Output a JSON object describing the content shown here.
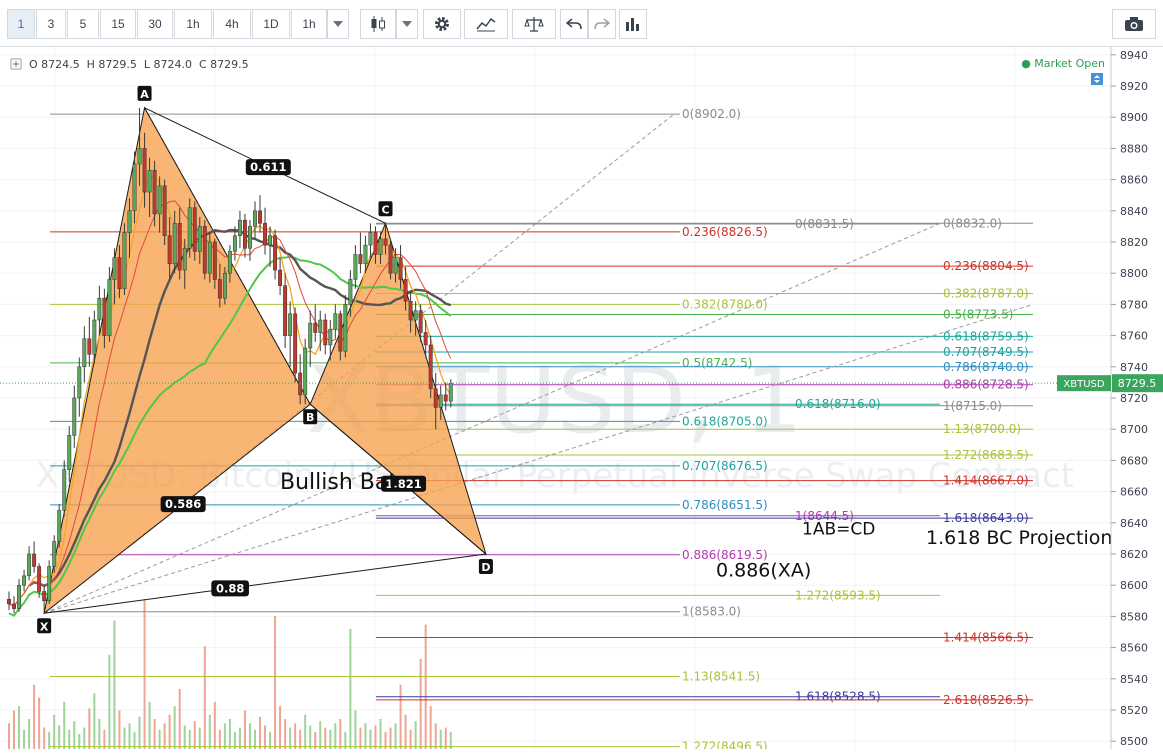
{
  "toolbar": {
    "intervals": [
      "1",
      "3",
      "5",
      "15",
      "30",
      "1h",
      "4h",
      "1D",
      "1h"
    ],
    "active_interval": "1"
  },
  "legend": {
    "ohlc": "O 8724.5  H 8729.5  L 8724.0  C 8729.5",
    "market_status": "● Market Open"
  },
  "watermark": {
    "symbol": "XBTUSD, 1",
    "description": "XBTUSD: Bitcoin / US Dollar Perpetual Inverse Swap Contract"
  },
  "price_tag": {
    "symbol": "XBTUSD",
    "price": "8729.5"
  },
  "colors": {
    "pattern_fill": "#f6a04d",
    "pattern_stroke": "#1a1a1a",
    "ma_green": "#4ec84a",
    "ma_dark": "#555555",
    "ma_orange": "#f5a623",
    "ma_red": "#e24a3a",
    "up_candle": "#5aa85a",
    "down_candle": "#c0392b"
  },
  "chart_data": {
    "type": "candlestick",
    "symbol": "XBTUSD",
    "interval": "1",
    "y_axis": {
      "min": 8495,
      "max": 8945,
      "ticks": [
        8500,
        8520,
        8540,
        8560,
        8580,
        8600,
        8620,
        8640,
        8660,
        8680,
        8700,
        8720,
        8740,
        8760,
        8780,
        8800,
        8820,
        8840,
        8860,
        8880,
        8900,
        8920,
        8940
      ]
    },
    "pattern": {
      "name": "Bullish Bat",
      "points": [
        {
          "label": "X",
          "bar": 7,
          "price": 8582
        },
        {
          "label": "A",
          "bar": 27,
          "price": 8906
        },
        {
          "label": "B",
          "bar": 60,
          "price": 8716
        },
        {
          "label": "C",
          "bar": 75,
          "price": 8832
        },
        {
          "label": "D",
          "bar": 95,
          "price": 8620
        }
      ],
      "ratios": [
        {
          "label": "0.611",
          "price": 8868
        },
        {
          "label": "0.586",
          "price": 8652
        },
        {
          "label": "1.821",
          "price": 8665
        },
        {
          "label": "0.88",
          "price": 8598
        }
      ]
    },
    "annotations": [
      {
        "text": "Bullish Bat",
        "price": 8666
      },
      {
        "text": "1AB=CD",
        "price": 8637
      },
      {
        "text": "1.618 BC Projection",
        "price": 8631
      },
      {
        "text": "0.886(XA)",
        "price": 8610
      }
    ],
    "fib_xa": [
      {
        "label": "0(8902.0)",
        "price": 8902.0,
        "color": "#8c8c8c"
      },
      {
        "label": "0.236(8826.5)",
        "price": 8826.5,
        "color": "#d0322a"
      },
      {
        "label": "0.382(8780.0)",
        "price": 8780.0,
        "color": "#a8c43a"
      },
      {
        "label": "0.5(8742.5)",
        "price": 8742.5,
        "color": "#4caf50"
      },
      {
        "label": "0.618(8705.0)",
        "price": 8705.0,
        "color": "#20a898"
      },
      {
        "label": "0.707(8676.5)",
        "price": 8676.5,
        "color": "#1fa2a0"
      },
      {
        "label": "0.786(8651.5)",
        "price": 8651.5,
        "color": "#2f8fc1"
      },
      {
        "label": "0.886(8619.5)",
        "price": 8619.5,
        "color": "#b03cb0"
      },
      {
        "label": "1(8583.0)",
        "price": 8583.0,
        "color": "#8c8c8c"
      },
      {
        "label": "1.13(8541.5)",
        "price": 8541.5,
        "color": "#a8c43a"
      },
      {
        "label": "1.272(8496.5)",
        "price": 8496.5,
        "color": "#a8c43a"
      }
    ],
    "fib_bc": [
      {
        "label": "0(8831.5)",
        "price": 8831.5,
        "color": "#8c8c8c"
      },
      {
        "label": "0.618(8716.0)",
        "price": 8716.0,
        "color": "#20a898"
      },
      {
        "label": "1(8644.5)",
        "price": 8644.5,
        "color": "#b03cb0"
      },
      {
        "label": "1.272(8593.5)",
        "price": 8593.5,
        "color": "#a8c43a"
      },
      {
        "label": "1.618(8528.5)",
        "price": 8528.5,
        "color": "#3a3aa0"
      }
    ],
    "fib_ext": [
      {
        "label": "0(8832.0)",
        "price": 8832.0,
        "color": "#8c8c8c"
      },
      {
        "label": "0.236(8804.5)",
        "price": 8804.5,
        "color": "#d0322a"
      },
      {
        "label": "0.382(8787.0)",
        "price": 8787.0,
        "color": "#a8c43a"
      },
      {
        "label": "0.5(8773.5)",
        "price": 8773.5,
        "color": "#4caf50"
      },
      {
        "label": "0.618(8759.5)",
        "price": 8759.5,
        "color": "#20a898"
      },
      {
        "label": "0.707(8749.5)",
        "price": 8749.5,
        "color": "#1fa2a0"
      },
      {
        "label": "0.786(8740.0)",
        "price": 8740.0,
        "color": "#2f8fc1"
      },
      {
        "label": "0.886(8728.5)",
        "price": 8728.5,
        "color": "#b03cb0"
      },
      {
        "label": "1(8715.0)",
        "price": 8715.0,
        "color": "#8c8c8c"
      },
      {
        "label": "1.13(8700.0)",
        "price": 8700.0,
        "color": "#a8c43a"
      },
      {
        "label": "1.272(8683.5)",
        "price": 8683.5,
        "color": "#a8c43a"
      },
      {
        "label": "1.414(8667.0)",
        "price": 8667.0,
        "color": "#d0322a"
      },
      {
        "label": "1.618(8643.0)",
        "price": 8643.0,
        "color": "#3a3aa0"
      },
      {
        "label": "1.414(8566.5)",
        "price": 8566.5,
        "color": "#d0322a"
      },
      {
        "label": "2.618(8526.5)",
        "price": 8526.5,
        "color": "#d0322a"
      }
    ],
    "candles": [
      [
        8591,
        8596,
        8584,
        8588
      ],
      [
        8588,
        8593,
        8582,
        8585
      ],
      [
        8585,
        8604,
        8583,
        8600
      ],
      [
        8600,
        8610,
        8596,
        8606
      ],
      [
        8606,
        8625,
        8603,
        8620
      ],
      [
        8620,
        8628,
        8608,
        8612
      ],
      [
        8612,
        8614,
        8592,
        8596
      ],
      [
        8596,
        8600,
        8582,
        8590
      ],
      [
        8590,
        8616,
        8588,
        8612
      ],
      [
        8612,
        8632,
        8608,
        8628
      ],
      [
        8628,
        8652,
        8624,
        8648
      ],
      [
        8648,
        8680,
        8644,
        8674
      ],
      [
        8674,
        8702,
        8666,
        8696
      ],
      [
        8696,
        8728,
        8688,
        8720
      ],
      [
        8720,
        8746,
        8708,
        8740
      ],
      [
        8740,
        8766,
        8730,
        8758
      ],
      [
        8758,
        8772,
        8740,
        8748
      ],
      [
        8748,
        8776,
        8742,
        8770
      ],
      [
        8770,
        8792,
        8760,
        8784
      ],
      [
        8784,
        8790,
        8752,
        8760
      ],
      [
        8760,
        8804,
        8756,
        8796
      ],
      [
        8796,
        8816,
        8780,
        8810
      ],
      [
        8810,
        8818,
        8784,
        8790
      ],
      [
        8790,
        8832,
        8786,
        8826
      ],
      [
        8826,
        8848,
        8810,
        8840
      ],
      [
        8840,
        8878,
        8832,
        8870
      ],
      [
        8870,
        8906,
        8856,
        8880
      ],
      [
        8880,
        8890,
        8842,
        8852
      ],
      [
        8852,
        8874,
        8836,
        8866
      ],
      [
        8866,
        8872,
        8830,
        8838
      ],
      [
        8838,
        8862,
        8826,
        8856
      ],
      [
        8856,
        8860,
        8818,
        8824
      ],
      [
        8824,
        8836,
        8796,
        8806
      ],
      [
        8806,
        8840,
        8800,
        8832
      ],
      [
        8832,
        8842,
        8796,
        8802
      ],
      [
        8802,
        8822,
        8790,
        8816
      ],
      [
        8816,
        8848,
        8810,
        8842
      ],
      [
        8842,
        8846,
        8808,
        8814
      ],
      [
        8814,
        8836,
        8806,
        8830
      ],
      [
        8830,
        8834,
        8796,
        8800
      ],
      [
        8800,
        8826,
        8794,
        8820
      ],
      [
        8820,
        8822,
        8790,
        8796
      ],
      [
        8796,
        8806,
        8778,
        8784
      ],
      [
        8784,
        8804,
        8780,
        8800
      ],
      [
        8800,
        8818,
        8794,
        8814
      ],
      [
        8814,
        8830,
        8808,
        8824
      ],
      [
        8824,
        8840,
        8816,
        8834
      ],
      [
        8834,
        8838,
        8810,
        8816
      ],
      [
        8816,
        8834,
        8808,
        8830
      ],
      [
        8830,
        8846,
        8822,
        8840
      ],
      [
        8840,
        8850,
        8826,
        8832
      ],
      [
        8832,
        8842,
        8812,
        8818
      ],
      [
        8818,
        8830,
        8804,
        8824
      ],
      [
        8824,
        8828,
        8796,
        8802
      ],
      [
        8802,
        8810,
        8786,
        8792
      ],
      [
        8792,
        8800,
        8752,
        8760
      ],
      [
        8760,
        8782,
        8740,
        8774
      ],
      [
        8774,
        8778,
        8730,
        8736
      ],
      [
        8736,
        8748,
        8716,
        8722
      ],
      [
        8722,
        8758,
        8716,
        8752
      ],
      [
        8752,
        8776,
        8740,
        8768
      ],
      [
        8768,
        8780,
        8756,
        8762
      ],
      [
        8762,
        8776,
        8750,
        8770
      ],
      [
        8770,
        8774,
        8748,
        8754
      ],
      [
        8754,
        8770,
        8744,
        8764
      ],
      [
        8764,
        8780,
        8758,
        8774
      ],
      [
        8774,
        8776,
        8744,
        8750
      ],
      [
        8750,
        8786,
        8746,
        8780
      ],
      [
        8780,
        8802,
        8772,
        8796
      ],
      [
        8796,
        8818,
        8790,
        8812
      ],
      [
        8812,
        8826,
        8800,
        8806
      ],
      [
        8806,
        8824,
        8800,
        8818
      ],
      [
        8818,
        8832,
        8810,
        8826
      ],
      [
        8826,
        8830,
        8806,
        8812
      ],
      [
        8812,
        8826,
        8806,
        8822
      ],
      [
        8822,
        8832,
        8812,
        8818
      ],
      [
        8818,
        8822,
        8796,
        8800
      ],
      [
        8800,
        8816,
        8794,
        8810
      ],
      [
        8810,
        8818,
        8790,
        8796
      ],
      [
        8796,
        8804,
        8776,
        8782
      ],
      [
        8782,
        8788,
        8762,
        8770
      ],
      [
        8770,
        8782,
        8760,
        8776
      ],
      [
        8776,
        8780,
        8756,
        8762
      ],
      [
        8762,
        8770,
        8746,
        8754
      ],
      [
        8754,
        8760,
        8720,
        8726
      ],
      [
        8726,
        8736,
        8700,
        8714
      ],
      [
        8714,
        8728,
        8706,
        8722
      ],
      [
        8722,
        8730,
        8712,
        8718
      ],
      [
        8718,
        8732,
        8714,
        8729.5
      ]
    ],
    "volumes": [
      12,
      18,
      20,
      9,
      14,
      30,
      24,
      10,
      8,
      16,
      11,
      22,
      9,
      13,
      7,
      10,
      19,
      26,
      14,
      9,
      44,
      60,
      18,
      10,
      12,
      8,
      15,
      70,
      22,
      14,
      9,
      12,
      16,
      20,
      28,
      11,
      9,
      13,
      10,
      48,
      16,
      22,
      9,
      12,
      14,
      8,
      10,
      18,
      12,
      9,
      15,
      11,
      8,
      62,
      20,
      14,
      10,
      12,
      9,
      16,
      11,
      8,
      13,
      10,
      9,
      12,
      14,
      8,
      56,
      18,
      10,
      12,
      9,
      11,
      14,
      8,
      10,
      12,
      30,
      16,
      9,
      13,
      42,
      58,
      20,
      12,
      9,
      10,
      8
    ]
  }
}
